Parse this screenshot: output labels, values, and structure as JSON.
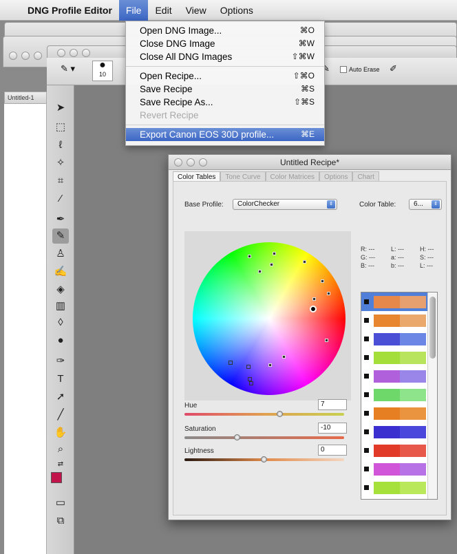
{
  "menubar": {
    "app_name": "DNG Profile Editor",
    "menus": [
      "File",
      "Edit",
      "View",
      "Options"
    ]
  },
  "file_menu": {
    "groups": [
      [
        {
          "label": "Open DNG Image...",
          "shortcut": "⌘O"
        },
        {
          "label": "Close DNG Image",
          "shortcut": "⌘W"
        },
        {
          "label": "Close All DNG Images",
          "shortcut": "⇧⌘W"
        }
      ],
      [
        {
          "label": "Open Recipe...",
          "shortcut": "⇧⌘O"
        },
        {
          "label": "Save Recipe",
          "shortcut": "⌘S"
        },
        {
          "label": "Save Recipe As...",
          "shortcut": "⇧⌘S"
        },
        {
          "label": "Revert Recipe",
          "shortcut": "",
          "disabled": true
        }
      ]
    ],
    "highlighted": {
      "label": "Export Canon EOS 30D profile...",
      "shortcut": "⌘E"
    }
  },
  "photoshop": {
    "doc_tab": "Untitled-1",
    "brush_size": "10",
    "auto_erase_label": "Auto Erase",
    "foreground_color": "#c0144a",
    "background_color": "#ffffff"
  },
  "recipe": {
    "title": "Untitled Recipe*",
    "tabs": [
      "Color Tables",
      "Tone Curve",
      "Color Matrices",
      "Options",
      "Chart"
    ],
    "base_profile_label": "Base Profile:",
    "base_profile_value": "ColorChecker",
    "color_table_label": "Color Table:",
    "color_table_value": "6...",
    "readouts": {
      "col1": [
        "R: ---",
        "G: ---",
        "B: ---"
      ],
      "col2": [
        "L: ---",
        "a: ---",
        "b: ---"
      ],
      "col3": [
        "H: ---",
        "S: ---",
        "L: ---"
      ]
    },
    "swatches": [
      {
        "a": "#e6884a",
        "b": "#e6a070",
        "selected": true
      },
      {
        "a": "#e8862f",
        "b": "#eba86d"
      },
      {
        "a": "#4a4fd6",
        "b": "#6c86e6"
      },
      {
        "a": "#a3de3a",
        "b": "#b7e45c"
      },
      {
        "a": "#b060da",
        "b": "#9a86e8"
      },
      {
        "a": "#6fd86a",
        "b": "#8ee48a"
      },
      {
        "a": "#e57f22",
        "b": "#ea9440"
      },
      {
        "a": "#3b2fd0",
        "b": "#4a48dc"
      },
      {
        "a": "#e23a28",
        "b": "#e8584a"
      },
      {
        "a": "#d055d8",
        "b": "#b773e6"
      },
      {
        "a": "#a6e03a",
        "b": "#b9e85a"
      }
    ],
    "sliders": [
      {
        "label": "Hue",
        "value": "7",
        "level": 0.6
      },
      {
        "label": "Saturation",
        "value": "-10",
        "level": 0.33
      },
      {
        "label": "Lightness",
        "value": "0",
        "level": 0.5
      }
    ]
  }
}
